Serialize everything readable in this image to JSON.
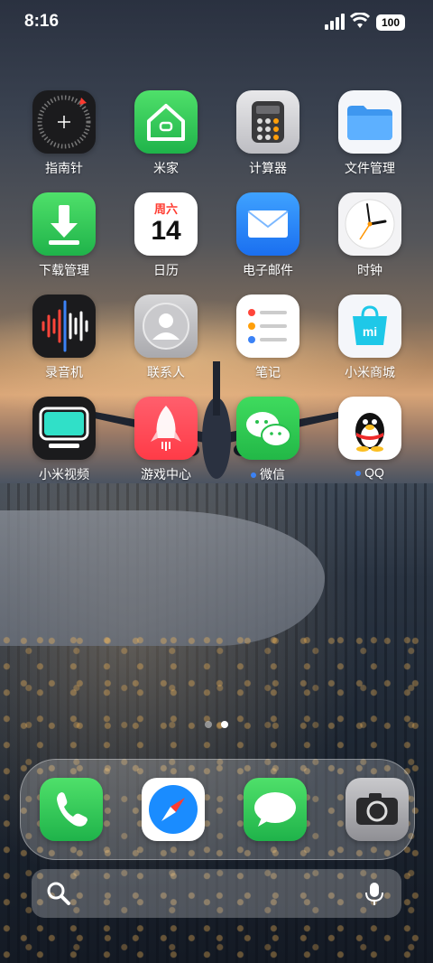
{
  "status_bar": {
    "time": "8:16",
    "battery": "100"
  },
  "apps": [
    {
      "label": "指南针",
      "icon": "compass-icon"
    },
    {
      "label": "米家",
      "icon": "mijia-home-icon"
    },
    {
      "label": "计算器",
      "icon": "calculator-icon"
    },
    {
      "label": "文件管理",
      "icon": "folder-icon"
    },
    {
      "label": "下载管理",
      "icon": "download-icon"
    },
    {
      "label": "日历",
      "icon": "calendar-icon",
      "weekday": "周六",
      "day": "14"
    },
    {
      "label": "电子邮件",
      "icon": "mail-icon"
    },
    {
      "label": "时钟",
      "icon": "clock-icon"
    },
    {
      "label": "录音机",
      "icon": "voice-recorder-icon"
    },
    {
      "label": "联系人",
      "icon": "contacts-icon"
    },
    {
      "label": "笔记",
      "icon": "notes-icon"
    },
    {
      "label": "小米商城",
      "icon": "mi-store-icon",
      "badge_text": "mi"
    },
    {
      "label": "小米视频",
      "icon": "tv-icon"
    },
    {
      "label": "游戏中心",
      "icon": "rocket-icon"
    },
    {
      "label": "微信",
      "icon": "wechat-icon"
    },
    {
      "label": "QQ",
      "icon": "qq-penguin-icon"
    }
  ],
  "pager": {
    "pages": 2,
    "active": 2
  },
  "dock": [
    {
      "icon": "phone-icon"
    },
    {
      "icon": "safari-compass-icon"
    },
    {
      "icon": "messages-icon"
    },
    {
      "icon": "camera-icon"
    }
  ],
  "colors": {
    "accent": "#3b82f6",
    "green": "#34c759",
    "wechat_green": "#2dc653"
  }
}
